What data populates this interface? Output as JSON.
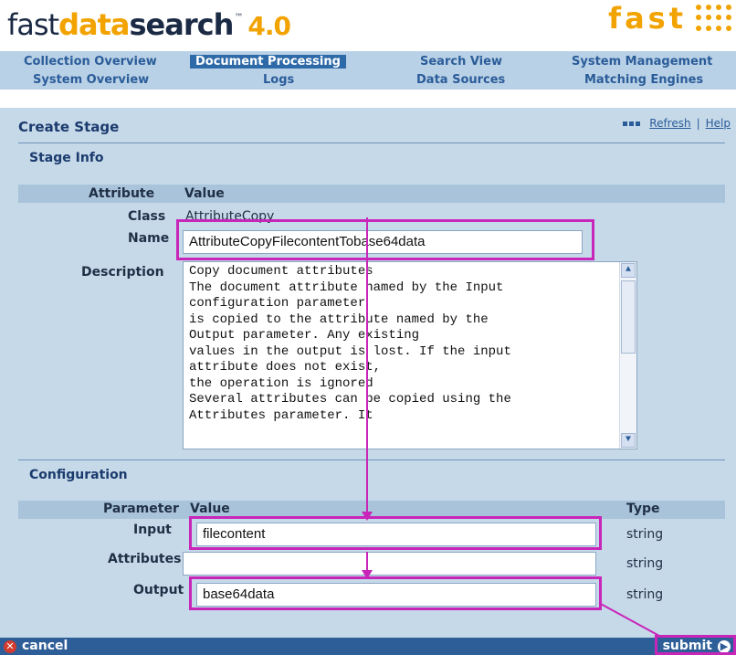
{
  "logo": {
    "fast": "fast",
    "data": "data",
    "search": "search",
    "tm": "™",
    "version": "4.0"
  },
  "brand": {
    "word": "fast"
  },
  "nav": {
    "row1": [
      "Collection Overview",
      "Document Processing",
      "Search View",
      "System Management"
    ],
    "row2": [
      "System Overview",
      "Logs",
      "Data Sources",
      "Matching Engines"
    ]
  },
  "page": {
    "title": "Create Stage",
    "refresh": "Refresh",
    "separator": "|",
    "help": "Help"
  },
  "stage_info": {
    "title": "Stage Info",
    "attribute_header": "Attribute",
    "value_header": "Value",
    "class_label": "Class",
    "class_value": "AttributeCopy",
    "name_label": "Name",
    "name_value": "AttributeCopyFilecontentTobase64data",
    "description_label": "Description",
    "description_lines": [
      "Copy document attributes",
      "The document attribute named by the Input",
      "configuration parameter",
      "is copied to the attribute named by the",
      "Output parameter. Any existing",
      "values in the output is lost. If the input",
      "attribute does not exist,",
      "the operation is ignored",
      "Several attributes can be copied using the",
      "Attributes parameter. It"
    ]
  },
  "configuration": {
    "title": "Configuration",
    "parameter_header": "Parameter",
    "value_header": "Value",
    "type_header": "Type",
    "rows": [
      {
        "label": "Input",
        "value": "filecontent",
        "type": "string"
      },
      {
        "label": "Attributes",
        "value": "",
        "type": "string"
      },
      {
        "label": "Output",
        "value": "base64data",
        "type": "string"
      }
    ]
  },
  "footer": {
    "cancel": "cancel",
    "submit": "submit"
  },
  "colors": {
    "accent": "#f2a300",
    "nav_active": "#2e6aa8",
    "highlight": "#c726b9",
    "panel": "#c6d9e9"
  },
  "icons": {
    "cancel": "cancel-icon",
    "submit": "submit-icon",
    "refresh_marker": "square-bullets-icon"
  }
}
